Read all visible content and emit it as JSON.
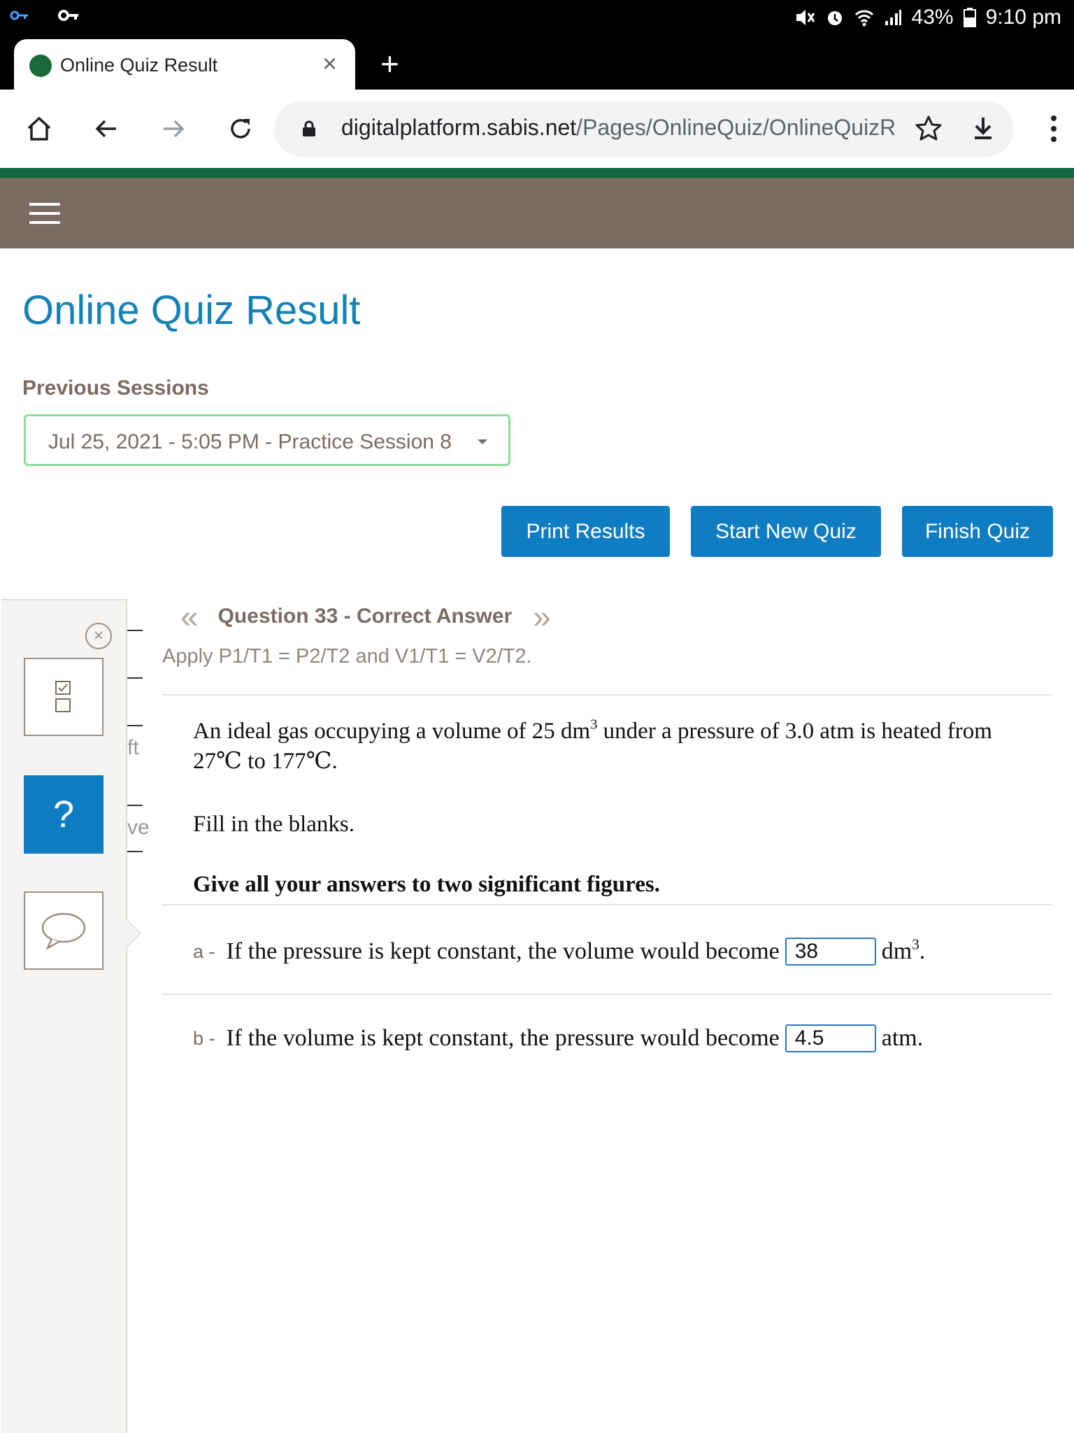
{
  "status_bar": {
    "battery": "43%",
    "time": "9:10 pm"
  },
  "browser": {
    "tab_title": "Online Quiz Result",
    "url_domain": "digitalplatform.sabis.net",
    "url_path": "/Pages/OnlineQuiz/OnlineQuizR"
  },
  "page": {
    "title": "Online Quiz Result",
    "previous_sessions_label": "Previous Sessions",
    "selected_session": "Jul 25, 2021 - 5:05 PM - Practice Session 8",
    "buttons": {
      "print": "Print Results",
      "start_new": "Start New Quiz",
      "finish": "Finish Quiz"
    }
  },
  "side_panel": {
    "help_glyph": "?",
    "peek_texts": [
      "ft",
      "ve"
    ]
  },
  "question": {
    "nav_prev": "«",
    "nav_next": "»",
    "heading": "Question 33 - Correct Answer",
    "hint": "Apply P1/T1 = P2/T2 and V1/T1 = V2/T2.",
    "body_part1": "An ideal gas occupying a volume of 25 dm",
    "body_sup": "3",
    "body_part2": " under a pressure of 3.0 atm is heated from 27℃ to 177℃.",
    "fill": "Fill in the blanks.",
    "instruction": "Give all your answers to two significant figures.",
    "parts": [
      {
        "letter": "a -",
        "text": "If the pressure is kept constant, the volume would become",
        "answer": "38",
        "unit": "dm",
        "unit_sup": "3",
        "unit_end": "."
      },
      {
        "letter": "b -",
        "text": "If the volume is kept constant, the pressure would become",
        "answer": "4.5",
        "unit": "atm.",
        "unit_sup": "",
        "unit_end": ""
      }
    ]
  },
  "colors": {
    "accent_blue": "#0f7dc2",
    "title_blue": "#1581b7",
    "header_brown": "#7b6b63",
    "brand_green": "#12683e",
    "select_border": "#8fdc96"
  }
}
